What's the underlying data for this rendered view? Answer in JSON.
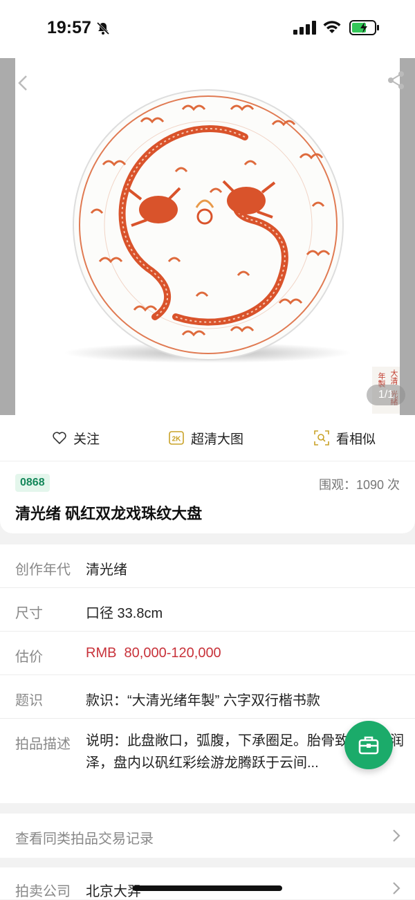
{
  "status_bar": {
    "time": "19:57"
  },
  "gallery": {
    "page_indicator": "1/1",
    "seal_text": [
      "大清",
      "光緒",
      "年製"
    ]
  },
  "actions": {
    "follow": "关注",
    "hd": "超清大图",
    "similar": "看相似",
    "hd_badge": "2K"
  },
  "lot": {
    "number": "0868",
    "views": "围观：1090 次",
    "title": "清光绪 矾红双龙戏珠纹大盘"
  },
  "details": [
    {
      "label": "创作年代",
      "value": "清光绪"
    },
    {
      "label": "尺寸",
      "value": "口径 33.8cm"
    },
    {
      "label": "估价",
      "value": "RMB  80,000-120,000"
    },
    {
      "label": "题识",
      "value": "款识：“大清光绪年製” 六字双行楷书款"
    },
    {
      "label": "拍品描述",
      "value": "说明：此盘敞口，弧腹，下承圈足。胎骨致，白釉润泽，盘内以矾红彩绘游龙腾跃于云间..."
    }
  ],
  "records": {
    "label": "查看同类拍品交易记录"
  },
  "company": {
    "label": "拍卖公司",
    "value": "北京大羿"
  },
  "colors": {
    "accent_green": "#1bab6a",
    "price_red": "#c8323a",
    "dragon_red": "#d9532b"
  }
}
